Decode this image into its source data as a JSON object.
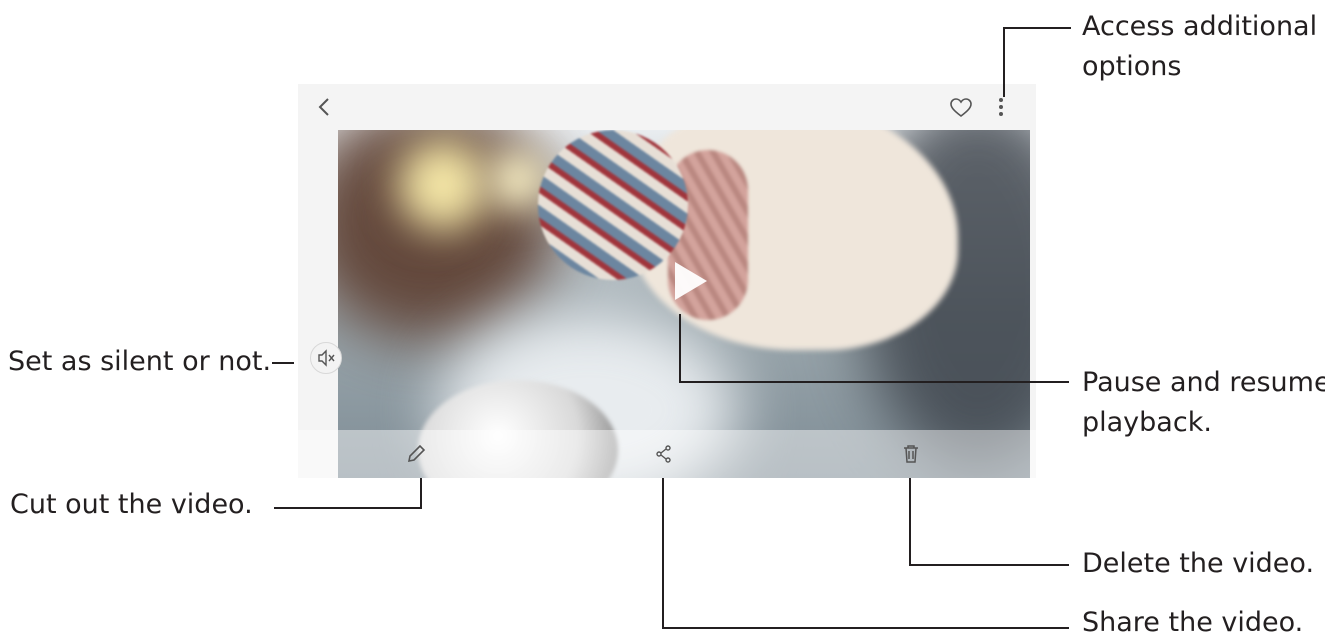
{
  "annotations": {
    "more_options": [
      "Access additional",
      "options"
    ],
    "mute": "Set as silent or not.",
    "play_pause": [
      "Pause and resume",
      "playback."
    ],
    "edit": "Cut out the video.",
    "delete": "Delete the video.",
    "share": "Share the video."
  },
  "icons": {
    "back": "chevron-left-icon",
    "favorite": "heart-icon",
    "more": "more-vert-icon",
    "mute": "speaker-mute-icon",
    "play": "play-icon",
    "edit": "pencil-icon",
    "share": "share-icon",
    "delete": "trash-icon"
  },
  "colors": {
    "callout": "#231f20",
    "icons": "#555555"
  }
}
